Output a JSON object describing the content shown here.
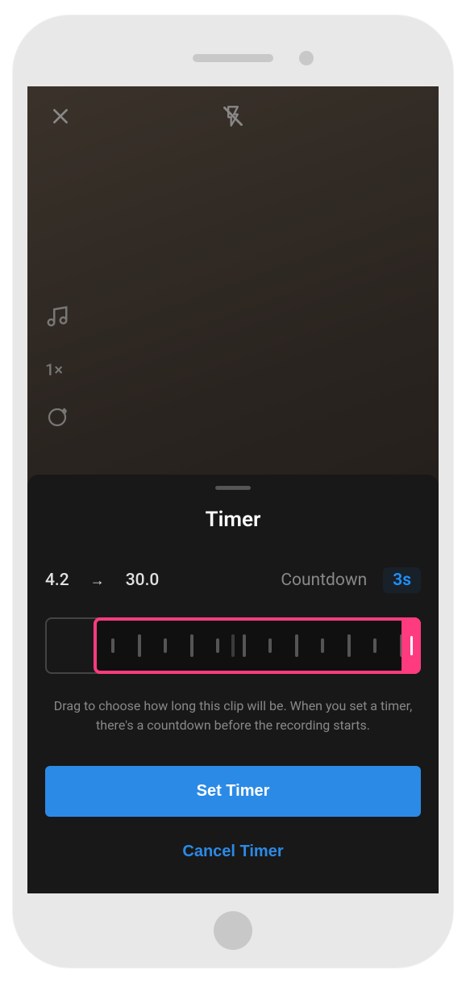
{
  "topbar": {
    "close_icon": "close-icon",
    "flash_icon": "flash-off-icon"
  },
  "sidebar": {
    "music_icon": "music-icon",
    "speed_label": "1×",
    "sparkle_icon": "sparkle-icon"
  },
  "sheet": {
    "title": "Timer",
    "start_time": "4.2",
    "end_time": "30.0",
    "countdown_label": "Countdown",
    "countdown_value": "3s",
    "helper_text": "Drag to choose how long this clip will be. When you set a timer, there's a countdown before the recording starts.",
    "set_button": "Set Timer",
    "cancel_button": "Cancel Timer"
  },
  "colors": {
    "accent_pink": "#ff3b7f",
    "accent_blue": "#2b8ae6"
  }
}
